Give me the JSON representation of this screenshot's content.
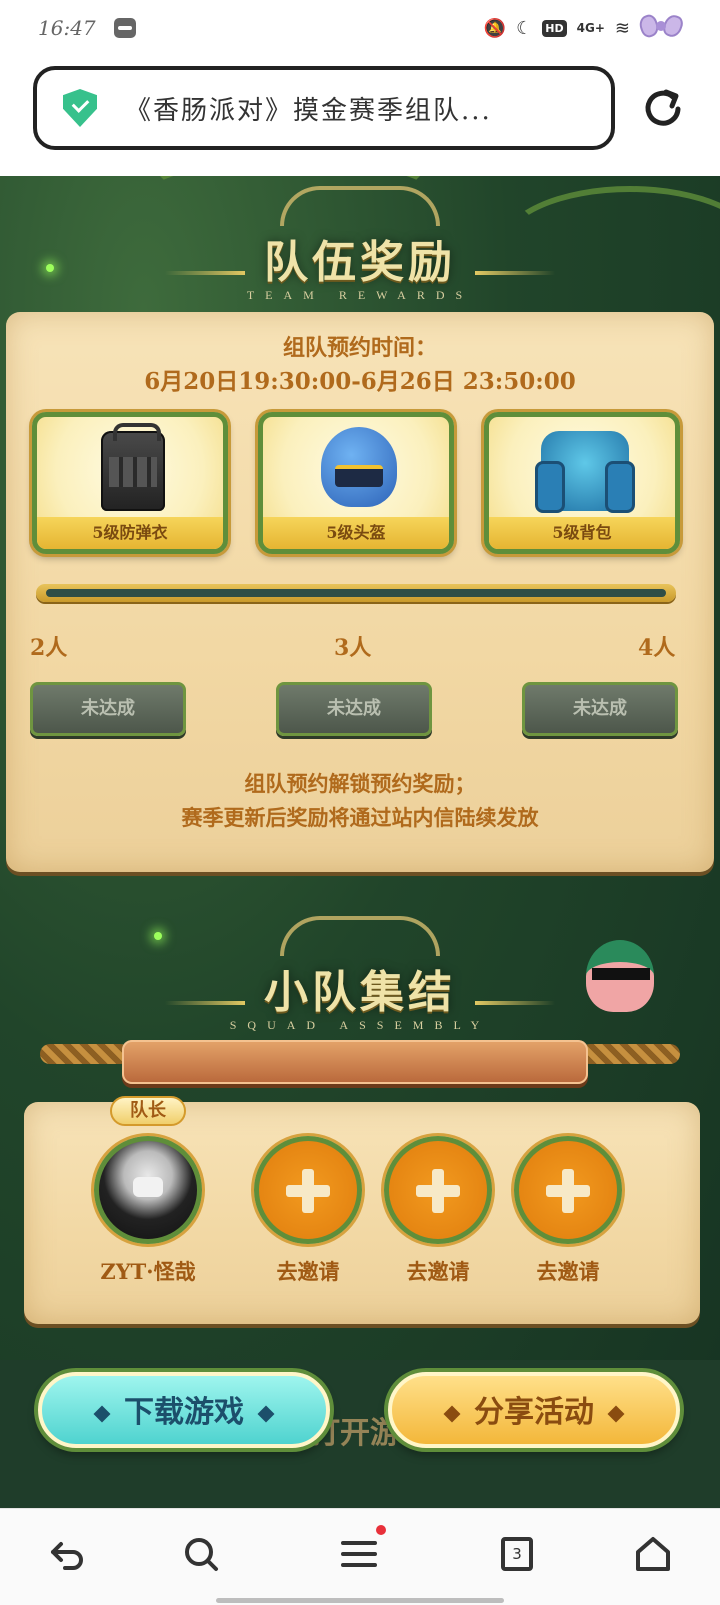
{
  "status_bar": {
    "time": "16:47",
    "hd": "HD",
    "network": "4G+"
  },
  "url_bar": {
    "title": "《香肠派对》摸金赛季组队..."
  },
  "rewards_section": {
    "title": "队伍奖励",
    "subtitle": "TEAM REWARDS",
    "reserve_label": "组队预约时间：",
    "reserve_time": "6月20日19:30:00-6月26日 23:50:00",
    "items": [
      {
        "label": "5级防弹衣",
        "icon": "armor-vest-icon"
      },
      {
        "label": "5级头盔",
        "icon": "helmet-icon"
      },
      {
        "label": "5级背包",
        "icon": "backpack-icon"
      }
    ],
    "progress": 0,
    "tiers": [
      {
        "people": "2人",
        "status": "未达成"
      },
      {
        "people": "3人",
        "status": "未达成"
      },
      {
        "people": "4人",
        "status": "未达成"
      }
    ],
    "notice_line1": "组队预约解锁预约奖励；",
    "notice_line2": "赛季更新后奖励将通过站内信陆续发放"
  },
  "squad_section": {
    "title": "小队集结",
    "subtitle": "SQUAD ASSEMBLY",
    "leader_badge": "队长",
    "leader_name": "ZYT·怪哉",
    "invite_label": "去邀请"
  },
  "actions": {
    "download": "下载游戏",
    "share": "分享活动",
    "open_game": "打开游戏"
  },
  "bottom_nav": {
    "tab_count": "3"
  },
  "colors": {
    "jungle_green": "#21452a",
    "parchment": "#f2d8a4",
    "accent_orange": "#b06a1c",
    "invite_orange": "#e07d0d"
  }
}
